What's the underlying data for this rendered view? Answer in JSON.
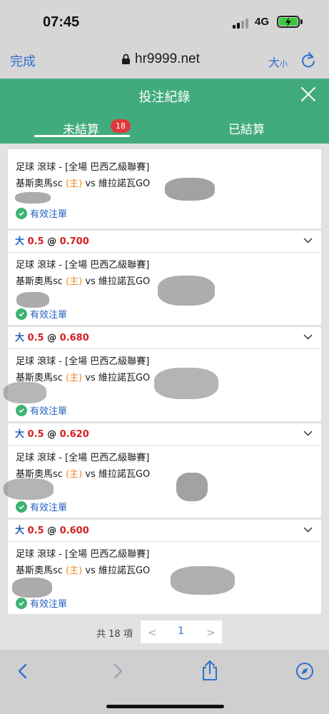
{
  "status_bar": {
    "time": "07:45",
    "network": "4G"
  },
  "browser": {
    "done_label": "完成",
    "url": "hr9999.net",
    "text_size_big": "大",
    "text_size_small": "小"
  },
  "modal": {
    "title": "投注紀錄",
    "tabs": [
      {
        "label": "未結算",
        "badge": "18"
      },
      {
        "label": "已結算"
      }
    ]
  },
  "bets": [
    {
      "side": "",
      "line": "",
      "at": "",
      "odds": "",
      "market": "足球 滾球 - [全場 巴西乙級聯賽]",
      "home_team": "基斯奧馬sc",
      "home_tag": "(主)",
      "vs": "vs",
      "away_team": "維拉諾瓦GO",
      "status": "有效注單"
    },
    {
      "side": "大",
      "line": "0.5",
      "at": "@",
      "odds": "0.700",
      "market": "足球 滾球 - [全場 巴西乙級聯賽]",
      "home_team": "基斯奧馬sc",
      "home_tag": "(主)",
      "vs": "vs",
      "away_team": "維拉諾瓦GO",
      "status": "有效注單"
    },
    {
      "side": "大",
      "line": "0.5",
      "at": "@",
      "odds": "0.680",
      "market": "足球 滾球 - [全場 巴西乙級聯賽]",
      "home_team": "基斯奧馬sc",
      "home_tag": "(主)",
      "vs": "vs",
      "away_team": "維拉諾瓦GO",
      "status": "有效注單"
    },
    {
      "side": "大",
      "line": "0.5",
      "at": "@",
      "odds": "0.620",
      "market": "足球 滾球 - [全場 巴西乙級聯賽]",
      "home_team": "基斯奧馬sc",
      "home_tag": "(主)",
      "vs": "vs",
      "away_team": "維拉諾瓦GO",
      "status": "有效注單"
    },
    {
      "side": "大",
      "line": "0.5",
      "at": "@",
      "odds": "0.600",
      "market": "足球 滾球 - [全場 巴西乙級聯賽]",
      "home_team": "基斯奧馬sc",
      "home_tag": "(主)",
      "vs": "vs",
      "away_team": "維拉諾瓦GO",
      "status": "有效注單"
    }
  ],
  "pagination": {
    "total": "共 18 項",
    "prev": "<",
    "current": "1",
    "next": ">"
  },
  "colors": {
    "header_green": "#42ab7d",
    "badge_red": "#e0393a",
    "link_blue": "#2f6fd0",
    "odds_red": "#d62020",
    "home_orange": "#f08a24"
  },
  "icons": [
    "lock-icon",
    "reload-icon",
    "close-icon",
    "chevron-down-icon",
    "check-circle-icon",
    "back-icon",
    "forward-icon",
    "share-icon",
    "compass-icon"
  ]
}
